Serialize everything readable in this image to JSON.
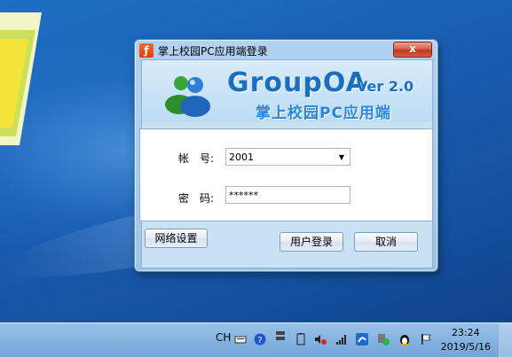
{
  "dialog": {
    "title": "掌上校园PC应用端登录",
    "close_label": "x",
    "brand": "GroupOA",
    "version": "Ver 2.0",
    "subtitle": "掌上校园PC应用端",
    "account_label": "帐　号:",
    "account_value": "2001",
    "password_label": "密　码:",
    "password_value": "******",
    "network_settings_label": "网络设置",
    "login_label": "用户登录",
    "cancel_label": "取消"
  },
  "taskbar": {
    "ime_label": "CH",
    "time": "23:24",
    "date": "2019/5/16"
  },
  "colors": {
    "brand_blue": "#1a6fbf",
    "close_red": "#c0391f",
    "desktop_blue": "#1a5fb4"
  }
}
